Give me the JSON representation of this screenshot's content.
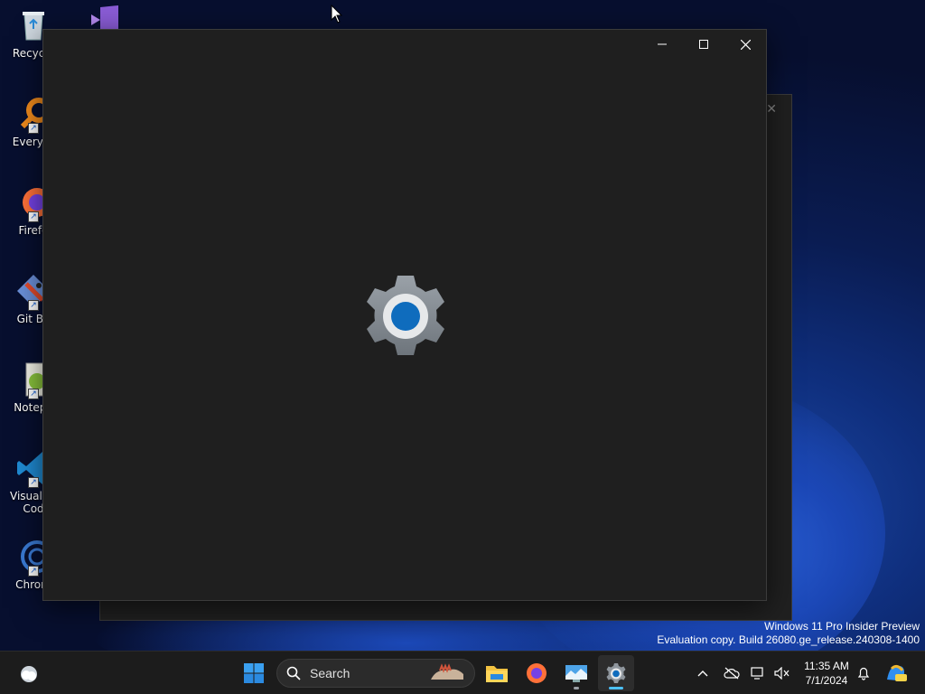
{
  "desktop": {
    "icons": [
      {
        "label": "Recycle",
        "icon": "recycle-bin-icon"
      },
      {
        "label": "Everyth",
        "icon": "everything-search-icon"
      },
      {
        "label": "Firefo",
        "icon": "firefox-icon"
      },
      {
        "label": "Git Ba",
        "icon": "git-bash-icon"
      },
      {
        "label": "Notepa",
        "icon": "notepad-plus-plus-icon"
      },
      {
        "label": "Visual St",
        "label2": "Cod",
        "icon": "vscode-icon"
      },
      {
        "label": "Chrom",
        "icon": "chrome-icon"
      }
    ]
  },
  "window": {
    "minimize_symbol": "—",
    "maximize_symbol": "☐",
    "close_symbol": "✕",
    "splash_icon": "settings-gear-icon"
  },
  "watermark": {
    "line1": "Windows 11 Pro Insider Preview",
    "line2": "Evaluation copy. Build 26080.ge_release.240308-1400"
  },
  "taskbar": {
    "search_label": "Search",
    "time": "11:35 AM",
    "date": "7/1/2024"
  },
  "colors": {
    "accent": "#0f6cbd",
    "window_bg": "#1f1f1f",
    "taskbar_bg": "#1c1c1c"
  }
}
